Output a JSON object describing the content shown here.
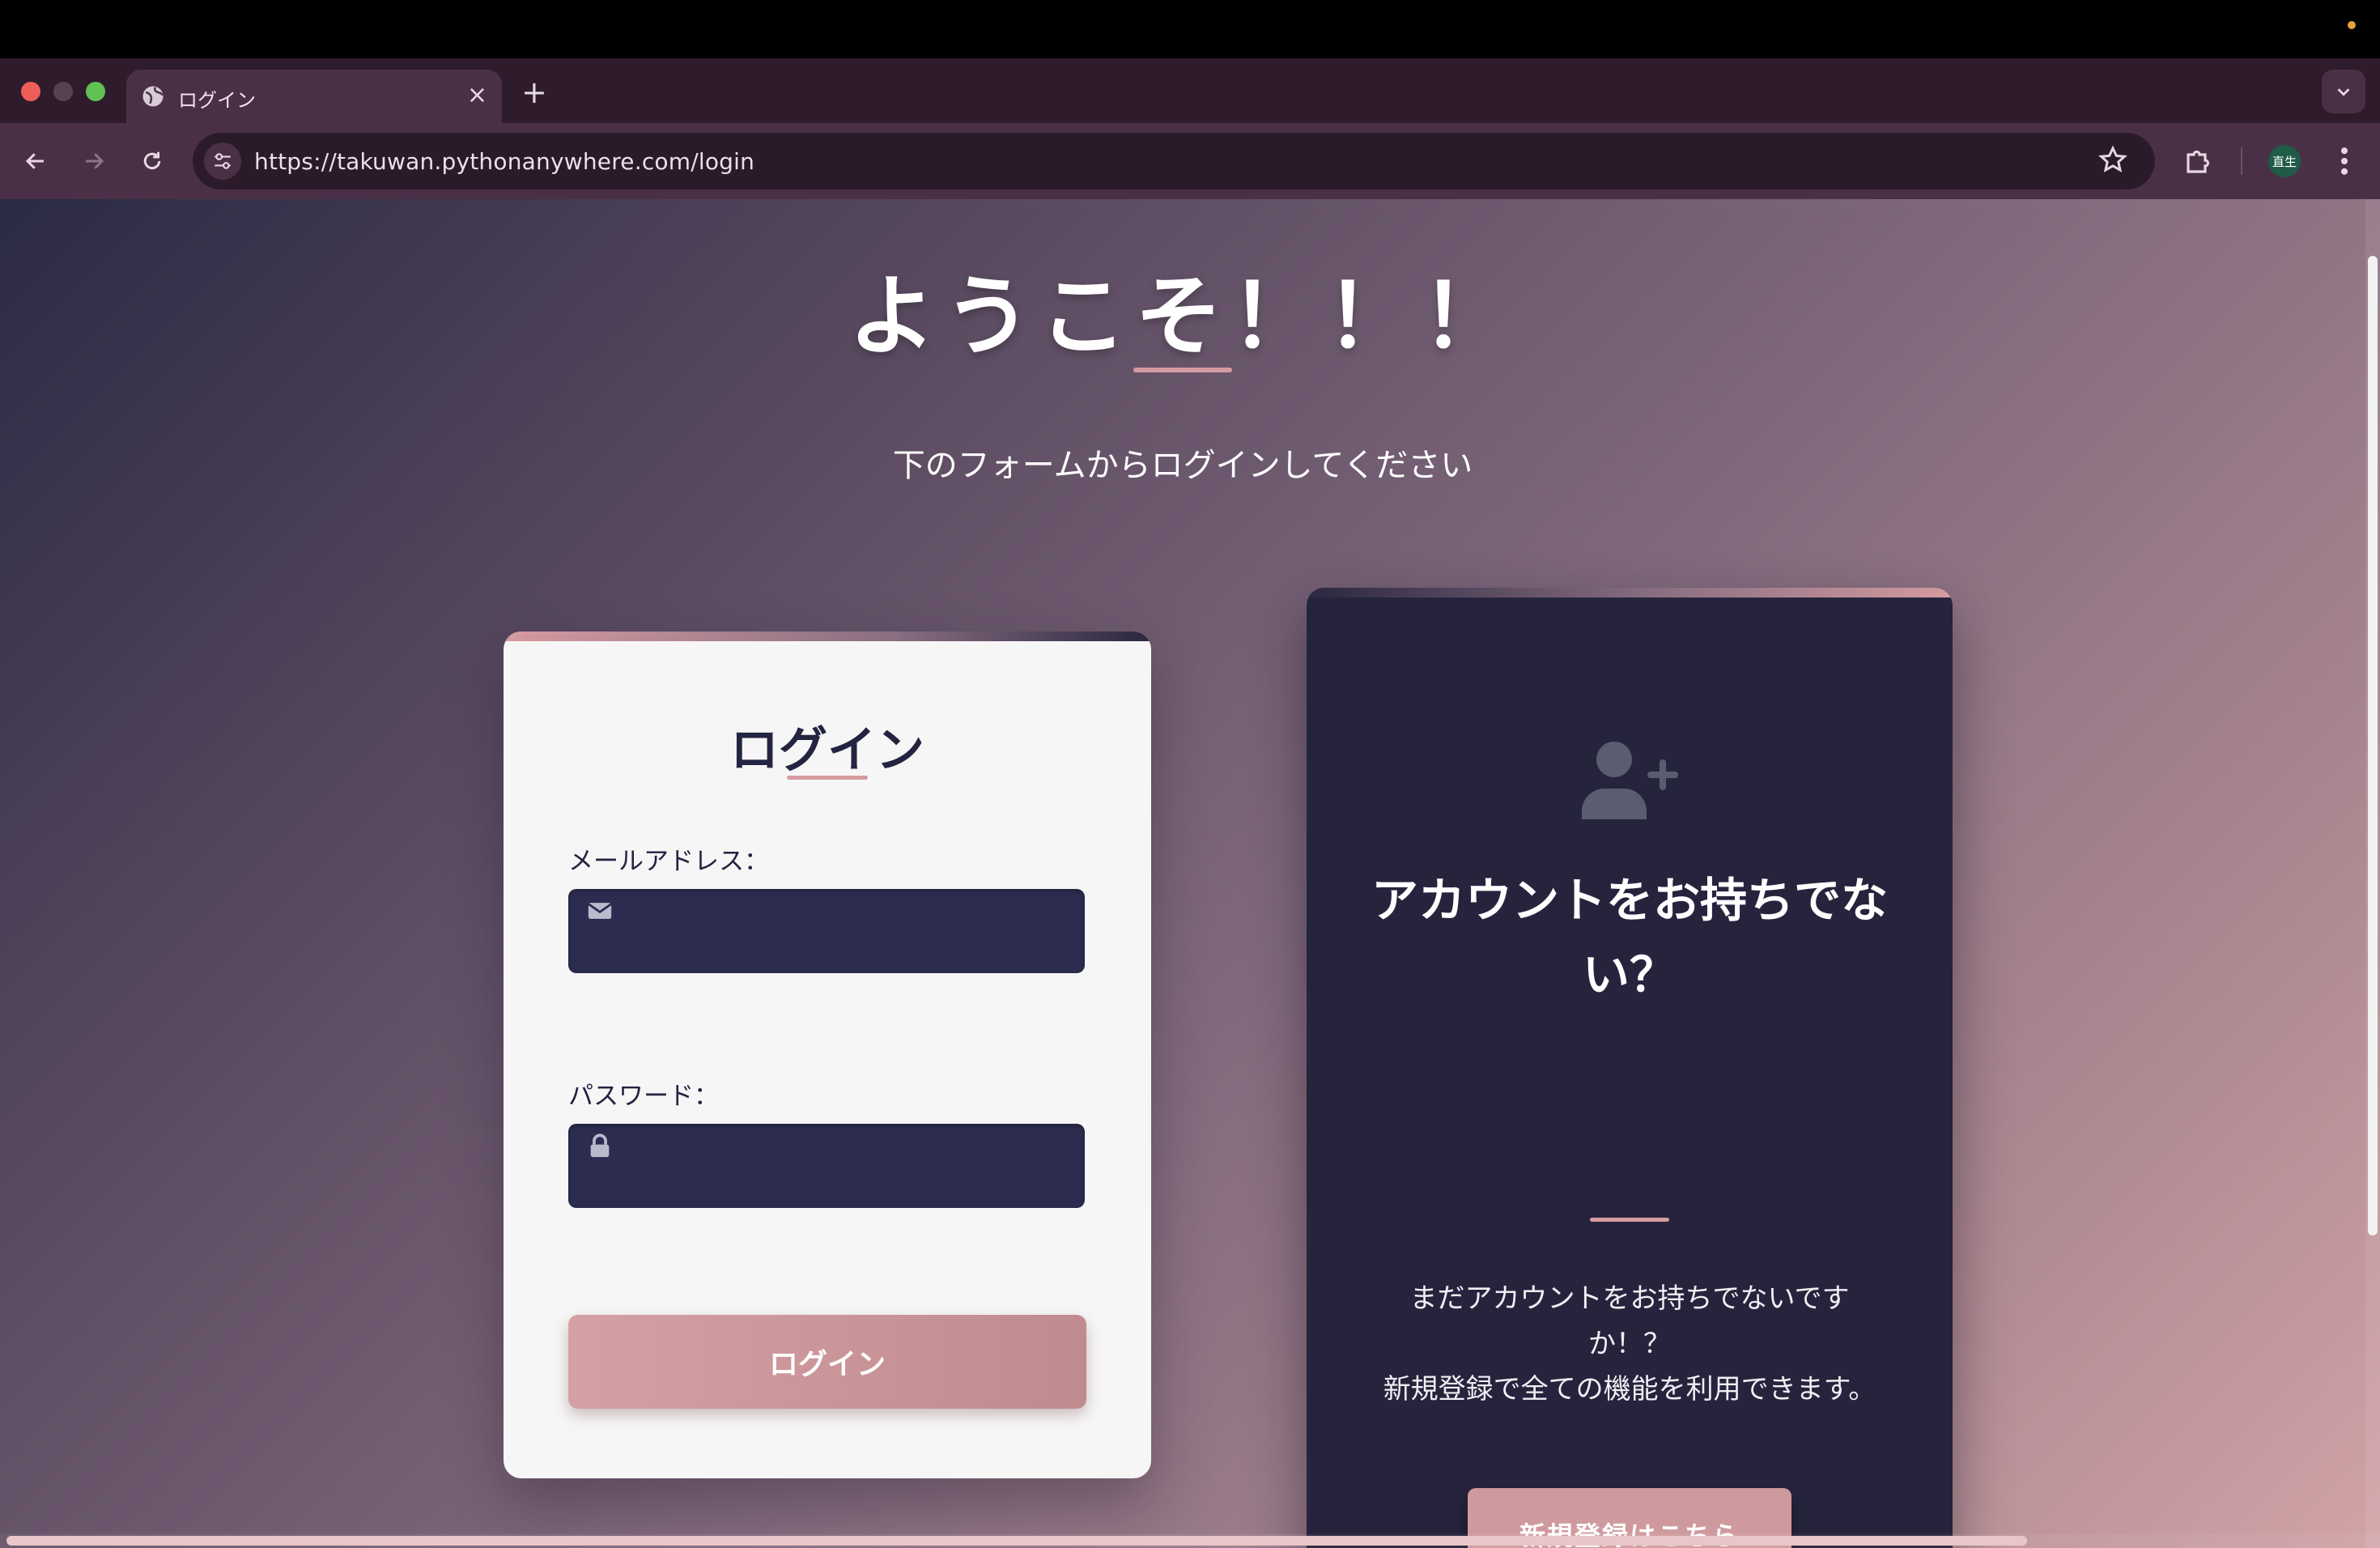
{
  "browser": {
    "tab_title": "ログイン",
    "new_tab": "+",
    "close": "×",
    "url": "https://takuwan.pythonanywhere.com/login",
    "profile_initials": "直生"
  },
  "page": {
    "welcome": "ようこそ！！！",
    "subtitle": "下のフォームからログインしてください"
  },
  "login_form": {
    "title": "ログイン",
    "email_label": "メールアドレス：",
    "password_label": "パスワード：",
    "email_value": "",
    "password_value": "",
    "submit_label": "ログイン"
  },
  "register_panel": {
    "title_line1": "アカウントをお持ちでな",
    "title_line2": "い？",
    "desc_line1": "まだアカウントをお持ちでないです",
    "desc_line2": "か！？",
    "desc_line3": "新規登録で全ての機能を利用できます。",
    "button_label": "新規登録はこちら"
  },
  "colors": {
    "accent": "#d59ba0",
    "card_dark": "#26243d",
    "input_bg": "#2b2c4f"
  },
  "icons": [
    "globe-icon",
    "close-icon",
    "plus-icon",
    "chevron-down-icon",
    "back-icon",
    "forward-icon",
    "reload-icon",
    "site-info-icon",
    "star-icon",
    "extensions-icon",
    "kebab-menu-icon",
    "envelope-icon",
    "lock-icon",
    "add-user-icon"
  ]
}
